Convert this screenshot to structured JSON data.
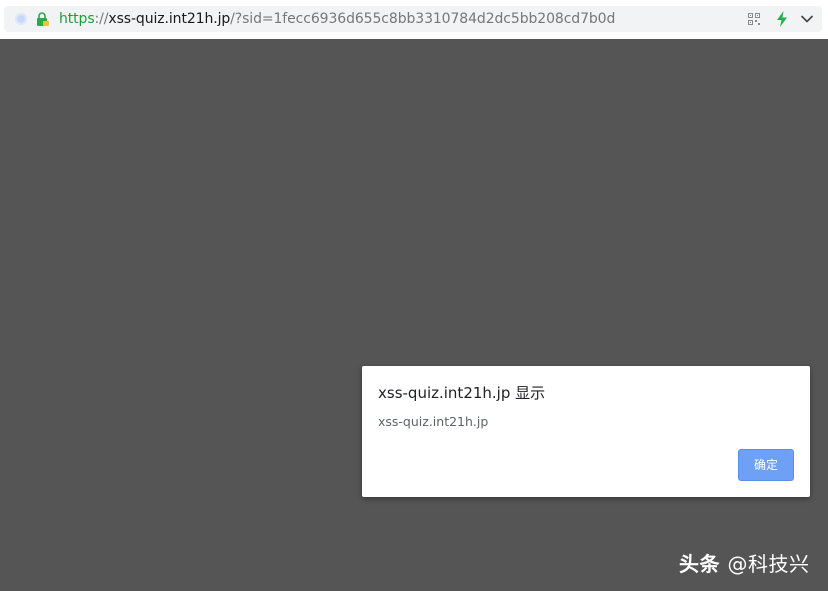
{
  "address_bar": {
    "url_scheme": "https",
    "url_separator": "://",
    "url_host": "xss-quiz.int21h.jp",
    "url_path": "/?sid=1fecc6936d655c8bb3310784d2dc5bb208cd7b0d",
    "icons": {
      "site_indicator": "site-info-dot-icon",
      "security": "lock-icon",
      "qr": "qr-code-icon",
      "speed": "lightning-bolt-icon",
      "menu": "chevron-down-icon"
    }
  },
  "dialog": {
    "title": "xss-quiz.int21h.jp 显示",
    "message": "xss-quiz.int21h.jp",
    "ok_label": "确定"
  },
  "watermark": {
    "brand": "头条",
    "handle": "@科技兴"
  },
  "colors": {
    "page_background": "#555555",
    "https_green": "#1a9e3a",
    "button_blue": "#6ea0f6",
    "bolt_green": "#22b14c"
  }
}
